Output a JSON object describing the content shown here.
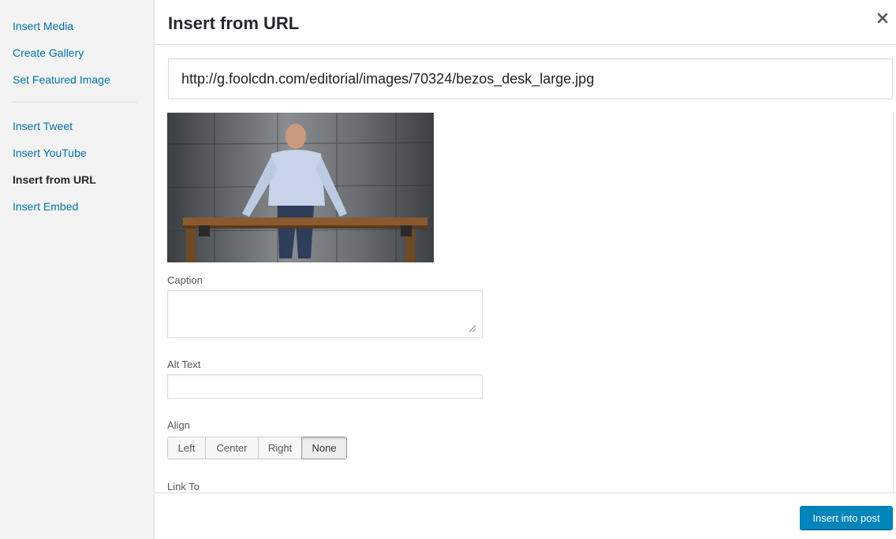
{
  "sidebar": {
    "items": [
      {
        "label": "Insert Media"
      },
      {
        "label": "Create Gallery"
      },
      {
        "label": "Set Featured Image"
      },
      {
        "label": "Insert Tweet"
      },
      {
        "label": "Insert YouTube"
      },
      {
        "label": "Insert from URL",
        "active": true
      },
      {
        "label": "Insert Embed"
      }
    ]
  },
  "frame": {
    "title": "Insert from URL",
    "close_icon": "close-icon"
  },
  "url_field": {
    "value": "http://g.foolcdn.com/editorial/images/70324/bezos_desk_large.jpg"
  },
  "fields": {
    "caption_label": "Caption",
    "caption_value": "",
    "alt_label": "Alt Text",
    "alt_value": "",
    "align_label": "Align",
    "align_options": [
      "Left",
      "Center",
      "Right",
      "None"
    ],
    "align_selected": "None",
    "link_label": "Link To"
  },
  "toolbar": {
    "insert_label": "Insert into post"
  },
  "colors": {
    "accent": "#0085ba",
    "link": "#0073aa",
    "sidebar_bg": "#f3f3f3"
  }
}
